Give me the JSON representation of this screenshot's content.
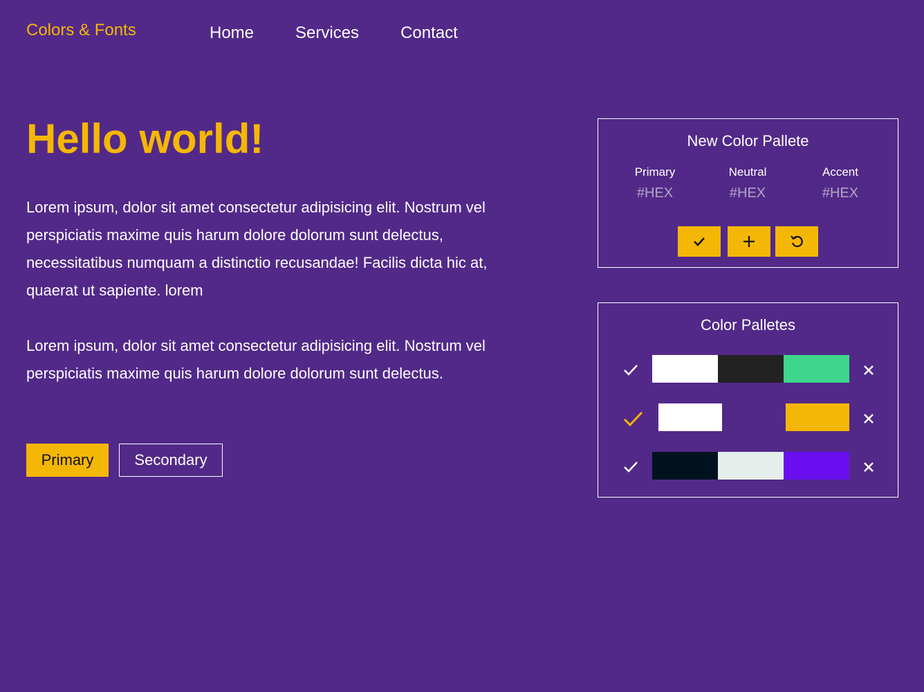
{
  "header": {
    "brand": "Colors & Fonts",
    "nav": [
      "Home",
      "Services",
      "Contact"
    ]
  },
  "hero": {
    "title": "Hello world!",
    "paragraphs": [
      "Lorem ipsum, dolor sit amet consectetur adipisicing elit. Nostrum vel perspiciatis maxime quis harum dolore dolorum sunt delectus, necessitatibus numquam a distinctio recusandae! Facilis dicta hic at, quaerat ut sapiente. lorem",
      "Lorem ipsum, dolor sit amet consectetur adipisicing elit. Nostrum vel perspiciatis maxime quis harum dolore dolorum sunt delectus."
    ],
    "buttons": {
      "primary": "Primary",
      "secondary": "Secondary"
    }
  },
  "new_palette": {
    "title": "New Color Pallete",
    "fields": [
      {
        "label": "Primary",
        "placeholder": "#HEX"
      },
      {
        "label": "Neutral",
        "placeholder": "#HEX"
      },
      {
        "label": "Accent",
        "placeholder": "#HEX"
      }
    ],
    "actions": [
      "check-icon",
      "plus-icon",
      "undo-icon"
    ]
  },
  "palettes": {
    "title": "Color Palletes",
    "rows": [
      {
        "active": false,
        "colors": [
          "#ffffff",
          "#222222",
          "#3dd68c"
        ]
      },
      {
        "active": true,
        "colors": [
          "#ffffff",
          "#522988",
          "#f5b705"
        ]
      },
      {
        "active": false,
        "colors": [
          "#001220",
          "#e5eeea",
          "#6a0ef0"
        ]
      }
    ]
  },
  "theme": {
    "background": "#522988",
    "accent": "#f5b705",
    "text": "#ffffff"
  }
}
